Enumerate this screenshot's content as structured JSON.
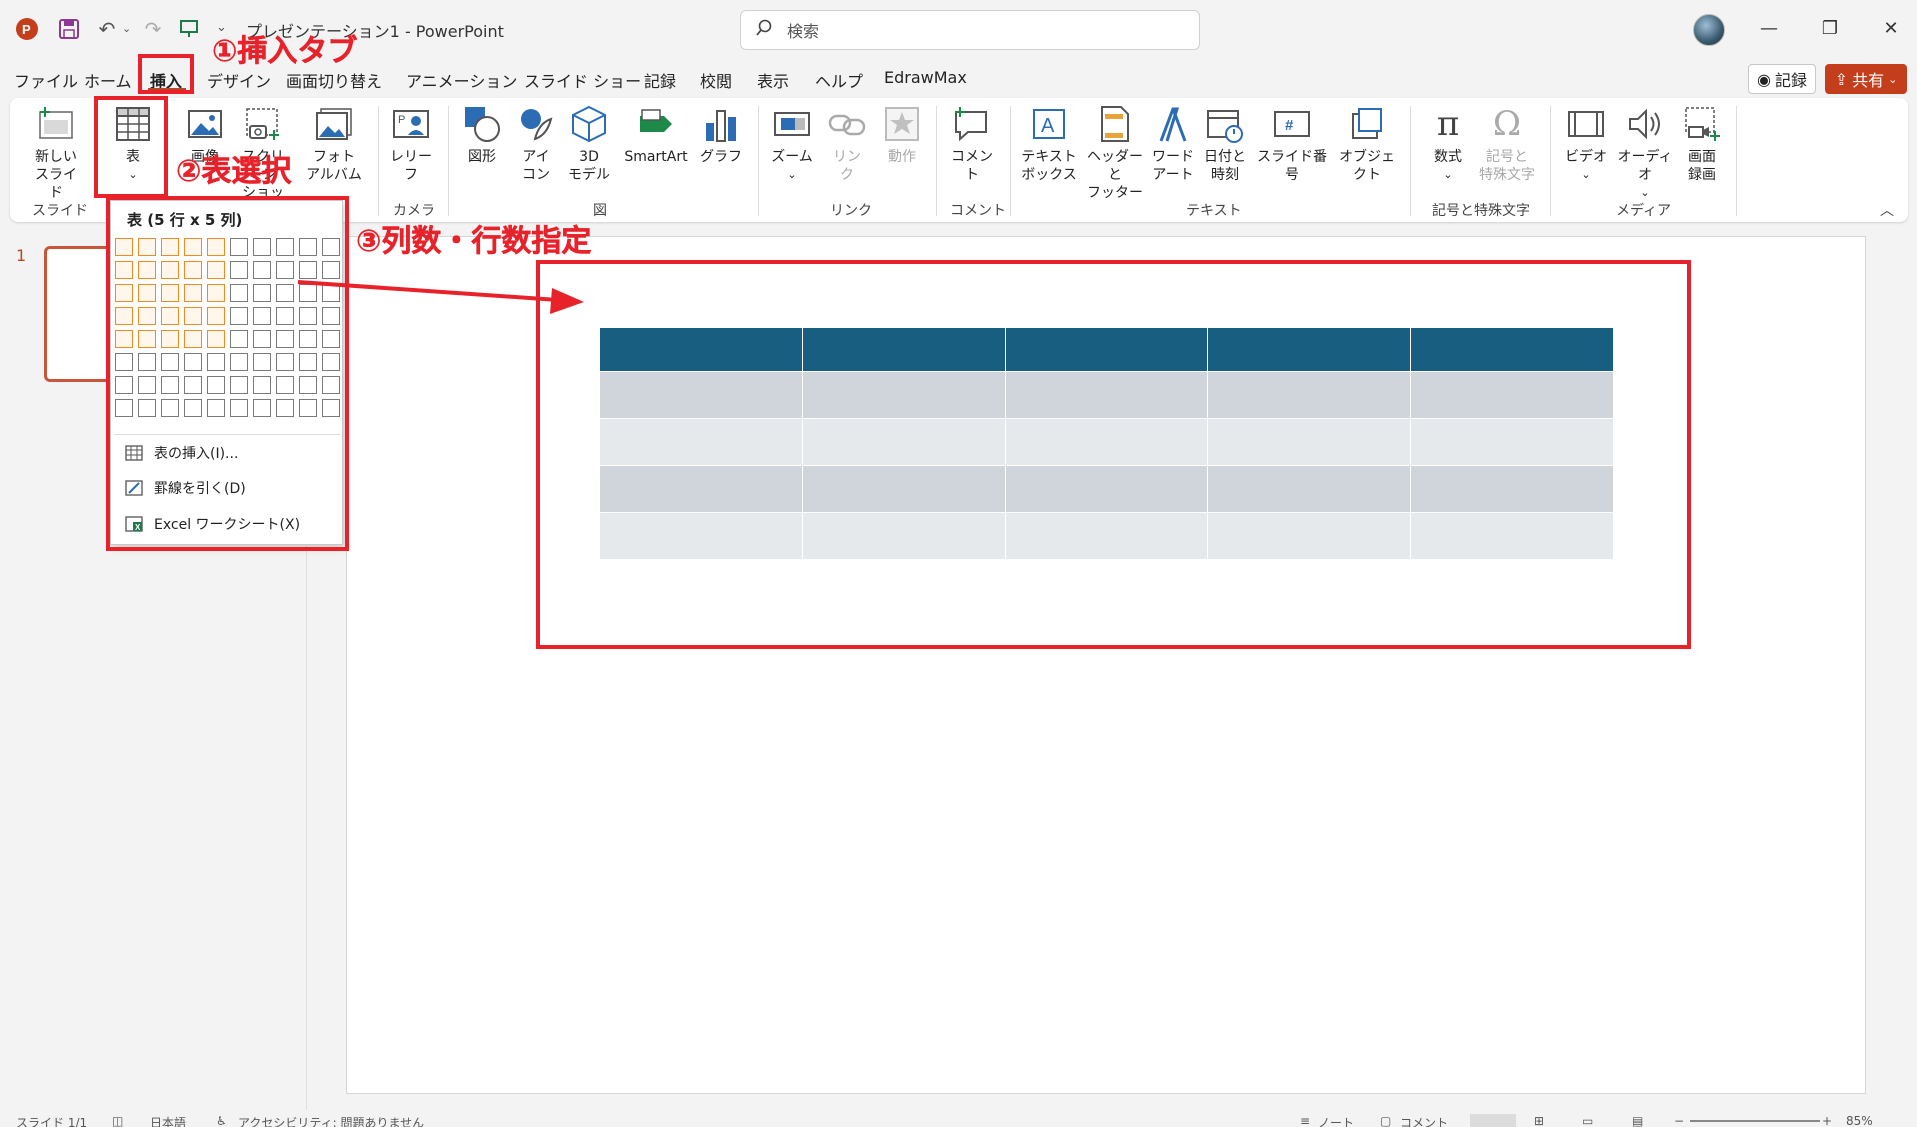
{
  "titlebar": {
    "title": "プレゼンテーション1 - PowerPoint",
    "search_placeholder": "検索",
    "app_icon": "powerpoint-icon"
  },
  "menu": {
    "tabs": [
      "ファイル",
      "ホーム",
      "挿入",
      "デザイン",
      "画面切り替え",
      "アニメーション",
      "スライド ショー",
      "記録",
      "校閲",
      "表示",
      "ヘルプ",
      "EdrawMax"
    ],
    "active_tab": "挿入",
    "record_label": "記録",
    "share_label": "共有"
  },
  "ribbon": {
    "new_slide": "新しい\nスライド",
    "table": "表",
    "image": "画像",
    "screenshot": "スクリーン\nショット",
    "photo_album": "フォト\nアルバム",
    "cameo": "レリー\nフ",
    "shapes": "図形",
    "icons": "アイ\nコン",
    "model3d": "3D\nモデル",
    "smartart": "SmartArt",
    "chart": "グラフ",
    "zoom": "ズーム",
    "link": "リン\nク",
    "action": "動作",
    "comment": "コメント",
    "textbox": "テキスト\nボックス",
    "header_footer": "ヘッダーと\nフッター",
    "wordart": "ワード\nアート",
    "datetime": "日付と\n時刻",
    "slide_number": "スライド番号",
    "object": "オブジェクト",
    "equation": "数式",
    "symbol": "記号と\n特殊文字",
    "video": "ビデオ",
    "audio": "オーディオ",
    "screen_recording": "画面\n録画",
    "groups": {
      "slides": "スライド",
      "camera": "カメラ",
      "illustrations": "図",
      "links": "リンク",
      "comments": "コメント",
      "text": "テキスト",
      "symbols": "記号と特殊文字",
      "media": "メディア"
    }
  },
  "slide_pane": {
    "slide_number": "1"
  },
  "table_dropdown": {
    "title": "表 (5 行 x 5 列)",
    "grid_cols": 10,
    "grid_rows": 8,
    "selected_cols": 5,
    "selected_rows": 5,
    "items": [
      "表の挿入(I)...",
      "罫線を引く(D)",
      "Excel ワークシート(X)"
    ]
  },
  "slide_table": {
    "rows": 5,
    "cols": 5,
    "header_color": "#175e80",
    "band_color_1": "#cfd5db",
    "band_color_2": "#e6e9ec"
  },
  "annotations": {
    "step1": "①挿入タブ",
    "step2": "②表選択",
    "step3": "③列数・行数指定",
    "color": "#e8222a"
  },
  "statusbar": {
    "slide_info": "スライド 1/1",
    "language": "日本語",
    "accessibility": "アクセシビリティ: 問題ありません",
    "notes": "ノート",
    "comments": "コメント",
    "zoom": "85%"
  },
  "colors": {
    "accent": "#b7472a",
    "share": "#c43e1c",
    "highlight": "#f08a24"
  }
}
